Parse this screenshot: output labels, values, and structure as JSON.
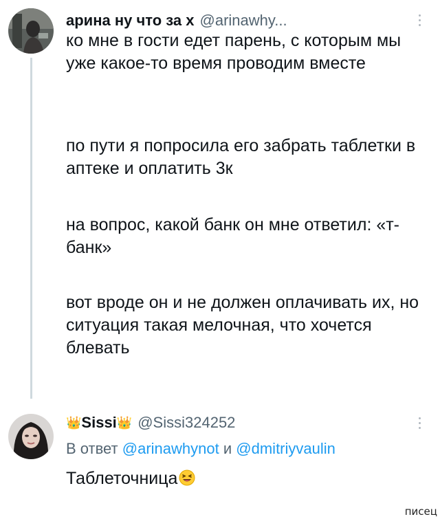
{
  "tweet": {
    "author_name": "арина ну что за х",
    "author_handle": "@arinawhy...",
    "paragraphs": [
      "ко мне в гости едет парень, с которым мы уже какое-то время проводим вместе",
      "по пути я попросила его забрать таблетки в аптеке и оплатить 3к",
      "на вопрос, какой банк он мне ответил: «т-банк»",
      "вот вроде он и не должен оплачивать их, но ситуация такая мелочная, что хочется блевать"
    ]
  },
  "reply": {
    "crown_left": "👑",
    "author_name": "Sissi",
    "crown_right": "👑",
    "author_handle": "@Sissi324252",
    "in_reply_prefix": "В ответ",
    "mention_1": "@arinawhynot",
    "conjunction": "и",
    "mention_2": "@dmitriyvaulin",
    "text": "Таблеточница",
    "emoji_icon": "laughing-emoji"
  },
  "watermark": "писец",
  "colors": {
    "link": "#1d9bf0",
    "secondary_text": "#536471",
    "thread_line": "#cfd9de"
  }
}
